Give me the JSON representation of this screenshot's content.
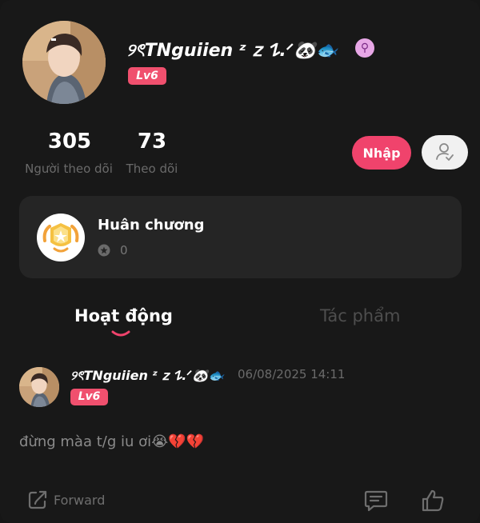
{
  "profile": {
    "username": "୨ৎTNguiien ᶻ 𝗓 𐰁.ᐟ🐼🐟",
    "gender_symbol": "⚲",
    "level": "Lv6"
  },
  "stats": [
    {
      "value": "305",
      "label": "Người theo dõi"
    },
    {
      "value": "73",
      "label": "Theo dõi"
    }
  ],
  "actions": {
    "join_label": "Nhập"
  },
  "medals": {
    "title": "Huân chương",
    "count": "0"
  },
  "tabs": [
    {
      "label": "Hoạt động",
      "active": true
    },
    {
      "label": "Tác phẩm",
      "active": false
    }
  ],
  "post": {
    "username": "୨ৎTNguiien ᶻ 𝗓 𐰁.ᐟ🐼🐟",
    "time": "06/08/2025 14:11",
    "level": "Lv6",
    "text": "đừng màa t/g iu ơi😭💔💔",
    "forward_label": "Forward"
  },
  "colors": {
    "background": "#181818",
    "accent": "#f0436c",
    "level_badge": "#f0506e",
    "card": "#252525"
  }
}
